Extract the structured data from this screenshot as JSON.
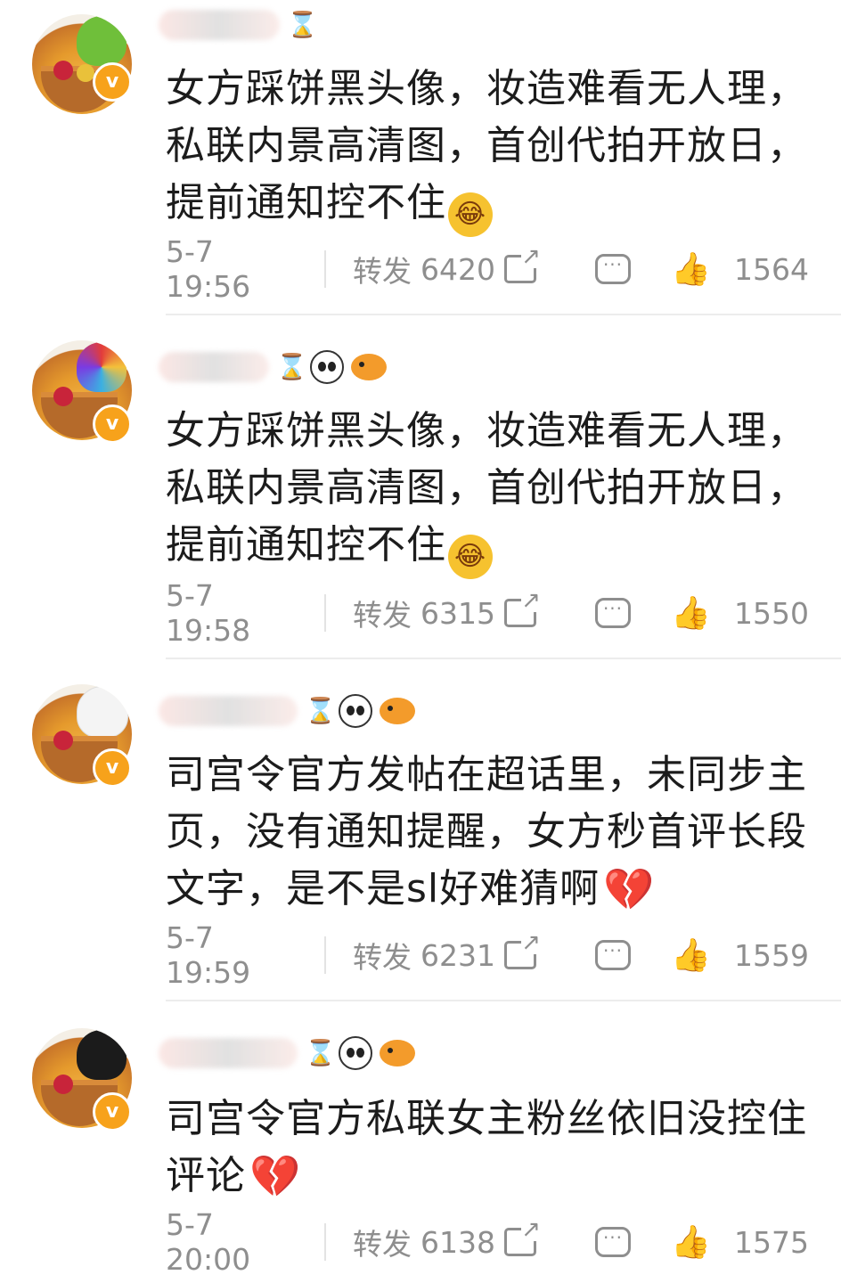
{
  "posts": [
    {
      "content_text": "女方踩饼黑头像，妆造难看无人理，私联内景高清图，首创代拍开放日，提前通知控不住",
      "emoji": "rofl-emoji",
      "time": "5-7 19:56",
      "repost_label": "转发",
      "repost_count": "6420",
      "like_count": "1564",
      "badges": [
        "hourglass-icon"
      ]
    },
    {
      "content_text": "女方踩饼黑头像，妆造难看无人理，私联内景高清图，首创代拍开放日，提前通知控不住",
      "emoji": "rofl-emoji",
      "time": "5-7 19:58",
      "repost_label": "转发",
      "repost_count": "6315",
      "like_count": "1550",
      "badges": [
        "hourglass-icon",
        "panda-icon",
        "fish-icon"
      ]
    },
    {
      "content_text": "司宫令官方发帖在超话里，未同步主页，没有通知提醒，女方秒首评长段文字，是不是sl好难猜啊",
      "emoji": "broken-heart-emoji",
      "time": "5-7 19:59",
      "repost_label": "转发",
      "repost_count": "6231",
      "like_count": "1559",
      "badges": [
        "hourglass-icon",
        "panda-icon",
        "fish-icon"
      ]
    },
    {
      "content_text": "司宫令官方私联女主粉丝依旧没控住评论",
      "emoji": "broken-heart-emoji",
      "time": "5-7 20:00",
      "repost_label": "转发",
      "repost_count": "6138",
      "like_count": "1575",
      "badges": [
        "hourglass-icon",
        "panda-icon",
        "fish-icon"
      ]
    }
  ],
  "verified_badge_glyph": "v",
  "colors": {
    "meta_text": "#8e8e8e",
    "badge": "#f7a21b",
    "heart": "#d8142a"
  }
}
